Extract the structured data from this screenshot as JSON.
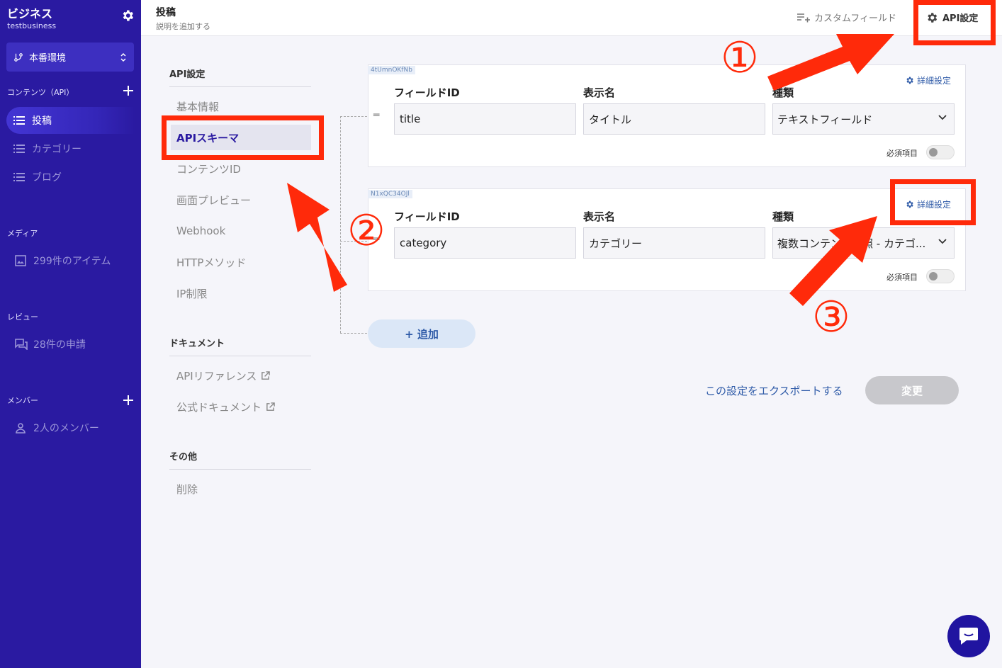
{
  "sidebar": {
    "title": "ビジネス",
    "subtitle": "testbusiness",
    "environment": "本番環境",
    "contents_label": "コンテンツ（API）",
    "items": [
      {
        "label": "投稿"
      },
      {
        "label": "カテゴリー"
      },
      {
        "label": "ブログ"
      }
    ],
    "media_label": "メディア",
    "media_item": "299件のアイテム",
    "review_label": "レビュー",
    "review_item": "28件の申請",
    "member_label": "メンバー",
    "member_item": "2人のメンバー"
  },
  "header": {
    "title": "投稿",
    "description": "説明を追加する",
    "custom_field": "カスタムフィールド",
    "api_settings": "API設定"
  },
  "menu": {
    "api_heading": "API設定",
    "api_items": [
      "基本情報",
      "APIスキーマ",
      "コンテンツID",
      "画面プレビュー",
      "Webhook",
      "HTTPメソッド",
      "IP制限"
    ],
    "doc_heading": "ドキュメント",
    "doc_items": [
      "APIリファレンス",
      "公式ドキュメント"
    ],
    "other_heading": "その他",
    "other_items": [
      "削除"
    ]
  },
  "fields": [
    {
      "id_tag": "4tUmnOKfNb",
      "field_id_label": "フィールドID",
      "display_name_label": "表示名",
      "type_label": "種類",
      "field_id": "title",
      "display_name": "タイトル",
      "type": "テキストフィールド",
      "detail": "詳細設定",
      "required_label": "必須項目",
      "required": false
    },
    {
      "id_tag": "N1xQC34OJl",
      "field_id_label": "フィールドID",
      "display_name_label": "表示名",
      "type_label": "種類",
      "field_id": "category",
      "display_name": "カテゴリー",
      "type": "複数コンテンツ参照 - カテゴ...",
      "detail": "詳細設定",
      "required_label": "必須項目",
      "required": false
    }
  ],
  "actions": {
    "add": "+ 追加",
    "export": "この設定をエクスポートする",
    "change": "変更"
  },
  "annotations": {
    "n1": "①",
    "n2": "②",
    "n3": "③",
    "color": "#ff2a0a"
  }
}
